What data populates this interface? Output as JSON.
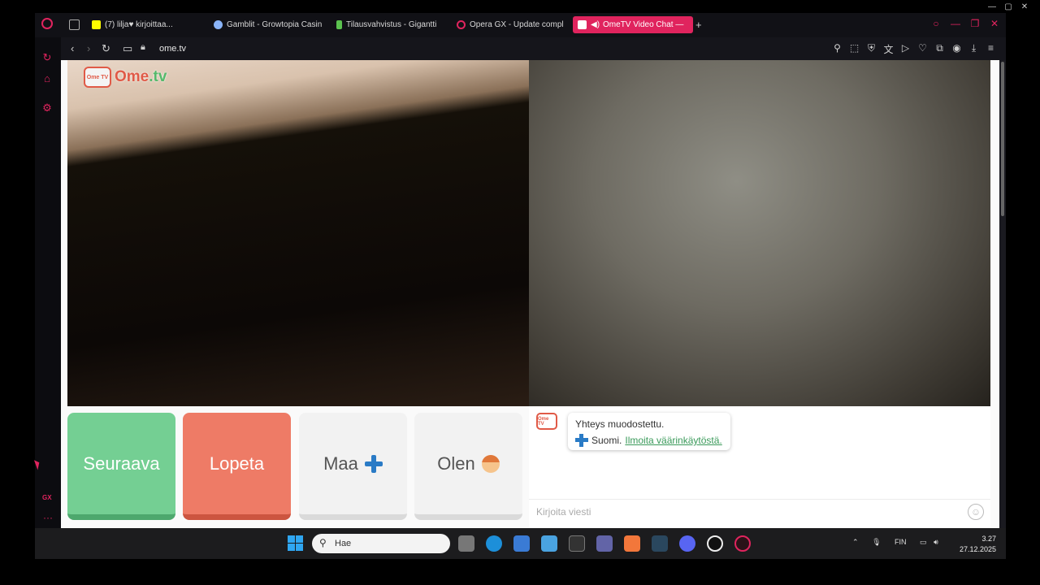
{
  "browser": {
    "tabs": [
      {
        "title": "(7) lilja♥ kirjoittaa...",
        "active": false
      },
      {
        "title": "Gamblit - Growtopia Casin",
        "active": false
      },
      {
        "title": "Tilausvahvistus - Gigantti",
        "active": false
      },
      {
        "title": "Opera GX - Update compl",
        "active": false
      },
      {
        "title": "OmeTV Video Chat — ",
        "active": true
      }
    ],
    "url": "ome.tv",
    "accent_color": "#e0245e",
    "sidebar_label": "GX"
  },
  "ometv": {
    "logo_text": "Ome",
    "logo_tv": ".tv",
    "logo_badge": "Ome TV",
    "buttons": {
      "next": "Seuraava",
      "stop": "Lopeta",
      "country": "Maa",
      "gender": "Olen"
    },
    "chat": {
      "connected_message": "Yhteys muodostettu.",
      "country_label": "Suomi.",
      "report_link": "Ilmoita väärinkäytöstä.",
      "input_placeholder": "Kirjoita viesti"
    },
    "colors": {
      "next": "#74cf93",
      "stop": "#ee7b66",
      "link": "#3a9a5a"
    }
  },
  "taskbar": {
    "search_placeholder": "Hae",
    "language": "FIN",
    "time": "3.27",
    "date": "27.12.2025"
  }
}
